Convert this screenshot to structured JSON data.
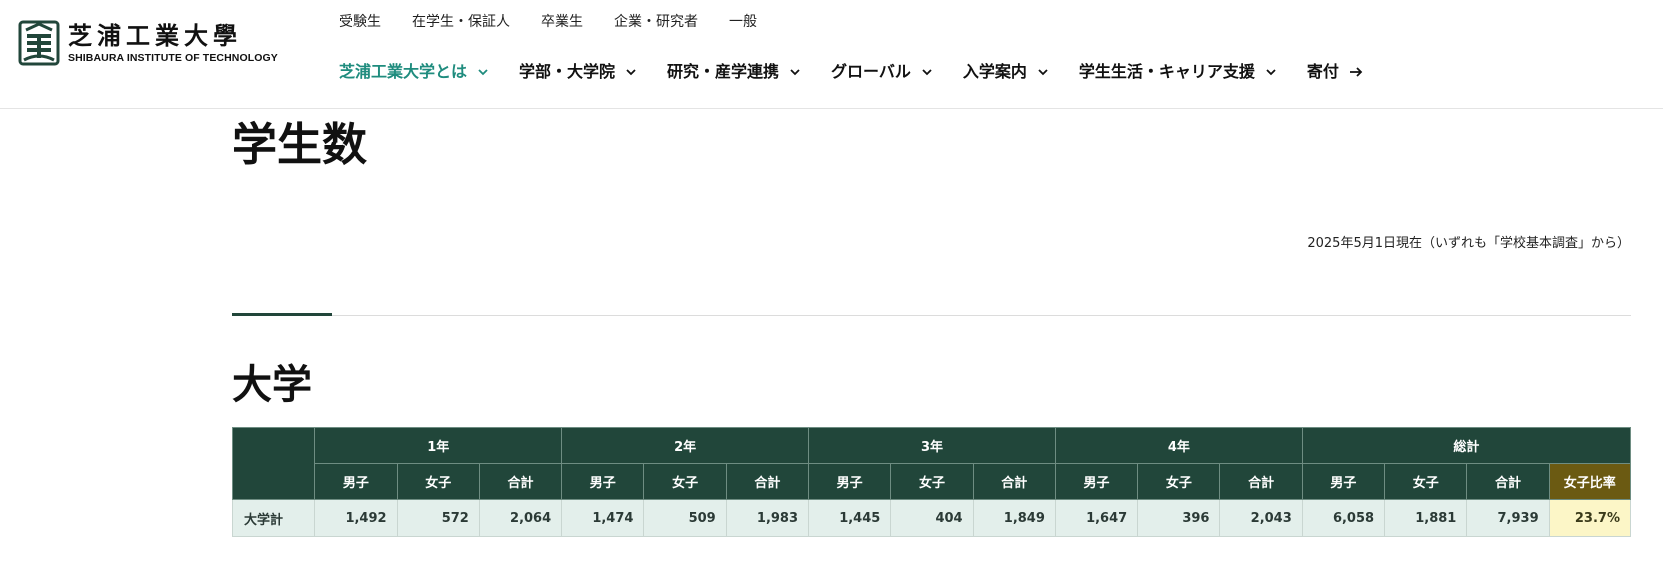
{
  "header": {
    "logo": {
      "jp": "芝浦工業大學",
      "en": "SHIBAURA INSTITUTE OF TECHNOLOGY"
    },
    "utility_nav": [
      "受験生",
      "在学生・保証人",
      "卒業生",
      "企業・研究者",
      "一般"
    ],
    "main_nav": [
      {
        "label": "芝浦工業大学とは",
        "active": true,
        "icon": "chevron-down-icon"
      },
      {
        "label": "学部・大学院",
        "active": false,
        "icon": "chevron-down-icon"
      },
      {
        "label": "研究・産学連携",
        "active": false,
        "icon": "chevron-down-icon"
      },
      {
        "label": "グローバル",
        "active": false,
        "icon": "chevron-down-icon"
      },
      {
        "label": "入学案内",
        "active": false,
        "icon": "chevron-down-icon"
      },
      {
        "label": "学生生活・キャリア支援",
        "active": false,
        "icon": "chevron-down-icon"
      },
      {
        "label": "寄付",
        "active": false,
        "icon": "arrow-right-icon"
      }
    ]
  },
  "page": {
    "title": "学生数",
    "as_of": "2025年5月1日現在（いずれも「学校基本調査」から）",
    "section_title": "大学"
  },
  "table": {
    "year_groups": [
      "1年",
      "2年",
      "3年",
      "4年",
      "総計"
    ],
    "sub_headers": [
      "男子",
      "女子",
      "合計"
    ],
    "ratio_header": "女子比率",
    "rows": [
      {
        "label": "大学計",
        "values": [
          "1,492",
          "572",
          "2,064",
          "1,474",
          "509",
          "1,983",
          "1,445",
          "404",
          "1,849",
          "1,647",
          "396",
          "2,043",
          "6,058",
          "1,881",
          "7,939"
        ],
        "ratio": "23.7%"
      }
    ]
  },
  "colors": {
    "brand_green": "#21463a",
    "active_nav": "#1f8c7e",
    "ratio_header": "#6b5a12",
    "ratio_cell": "#fcf6c7",
    "body_cell": "#e3efeb"
  }
}
